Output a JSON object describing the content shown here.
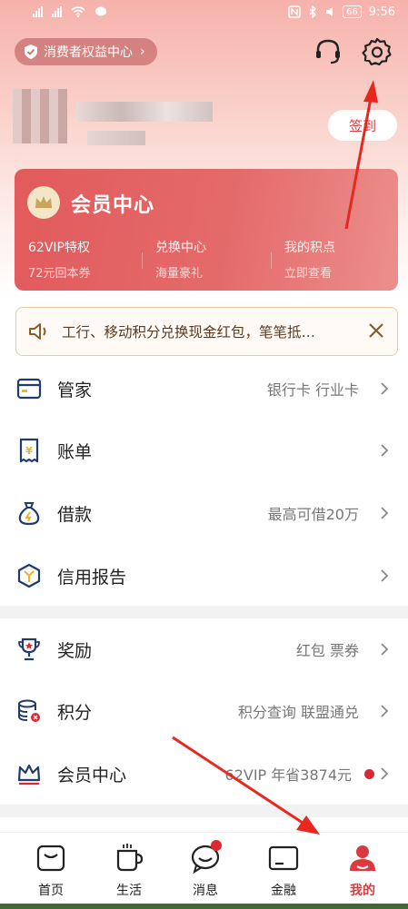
{
  "status_bar": {
    "left": [
      "HD 1",
      "HD 2"
    ],
    "time": "9:56",
    "battery": "66"
  },
  "header": {
    "consumer_rights": "消费者权益中心",
    "signin": "签到"
  },
  "member_card": {
    "title": "会员中心",
    "columns": [
      {
        "title": "62VIP特权",
        "sub": "72元回本券"
      },
      {
        "title": "兑换中心",
        "sub": "海量豪礼"
      },
      {
        "title": "我的积点",
        "sub": "立即查看"
      }
    ]
  },
  "notice": {
    "text": "工行、移动积分兑换现金红包，笔笔抵…"
  },
  "menu_group_1": [
    {
      "label": "管家",
      "right": "银行卡 行业卡"
    },
    {
      "label": "账单",
      "right": ""
    },
    {
      "label": "借款",
      "right": "最高可借20万"
    },
    {
      "label": "信用报告",
      "right": ""
    }
  ],
  "menu_group_2": [
    {
      "label": "奖励",
      "right": "红包 票券"
    },
    {
      "label": "积分",
      "right": "积分查询 联盟通兑"
    },
    {
      "label": "会员中心",
      "right": "62VIP 年省3874元"
    }
  ],
  "bottom_nav": [
    {
      "label": "首页"
    },
    {
      "label": "生活"
    },
    {
      "label": "消息"
    },
    {
      "label": "金融"
    },
    {
      "label": "我的"
    }
  ],
  "colors": {
    "accent": "#d9393f",
    "card": "#e25a5c"
  }
}
